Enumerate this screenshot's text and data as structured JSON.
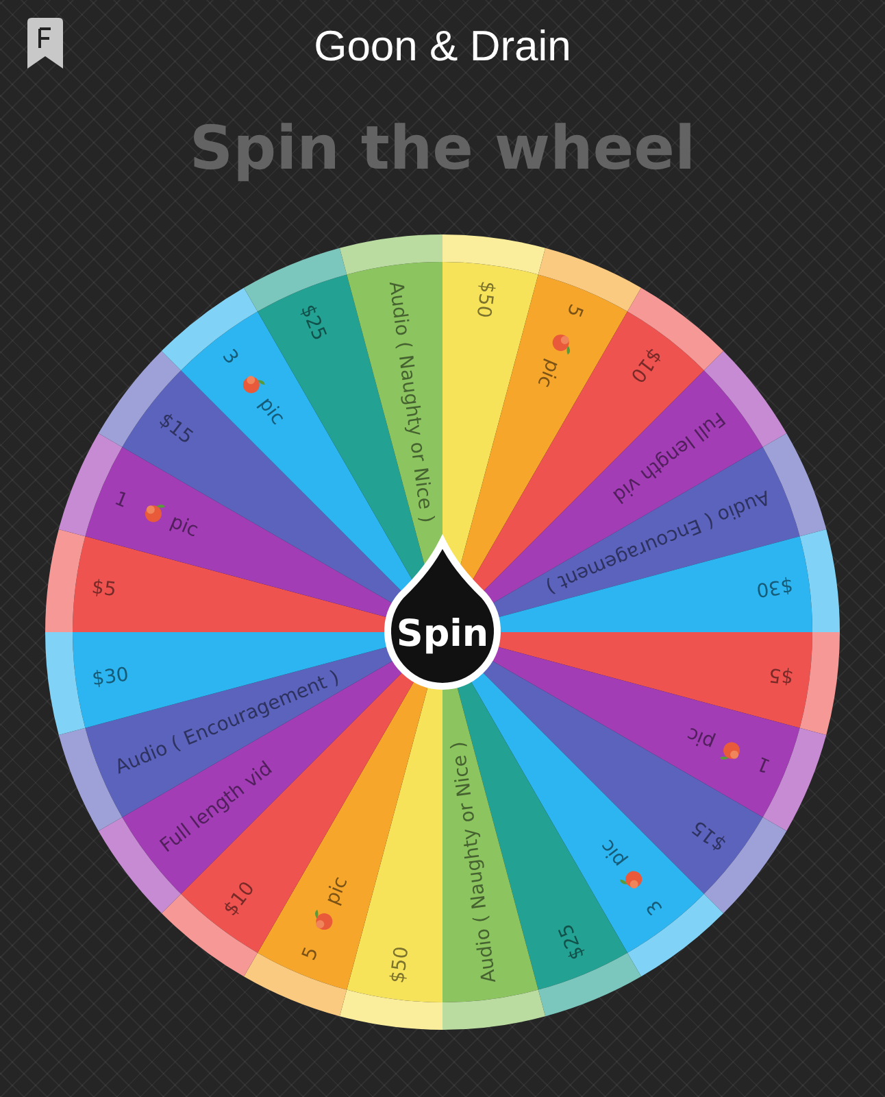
{
  "app_bar": {
    "title": "Goon & Drain"
  },
  "heading": "Spin the wheel",
  "wheel": {
    "button": "Spin",
    "segments": [
      {
        "kind": "text",
        "label": "$50",
        "color": "#f6e35a"
      },
      {
        "kind": "pic",
        "count": "5",
        "label": "pic",
        "color": "#f7a62c"
      },
      {
        "kind": "text",
        "label": "$10",
        "color": "#ef5350"
      },
      {
        "kind": "text",
        "label": "Full length vid",
        "color": "#a23db6"
      },
      {
        "kind": "text",
        "label": "Audio ( Encouragement )",
        "color": "#5c63bd"
      },
      {
        "kind": "text",
        "label": "$30",
        "color": "#2cb5f0"
      },
      {
        "kind": "text",
        "label": "$5",
        "color": "#ef5350"
      },
      {
        "kind": "pic",
        "count": "1",
        "label": "pic",
        "color": "#a23db6"
      },
      {
        "kind": "text",
        "label": "$15",
        "color": "#5c63bd"
      },
      {
        "kind": "pic",
        "count": "3",
        "label": "pic",
        "color": "#2cb5f0"
      },
      {
        "kind": "text",
        "label": "$25",
        "color": "#23a193"
      },
      {
        "kind": "text",
        "label": "Audio ( Naughty or Nice )",
        "color": "#8cc460"
      },
      {
        "kind": "text",
        "label": "$50",
        "color": "#f6e35a"
      },
      {
        "kind": "pic",
        "count": "5",
        "label": "pic",
        "color": "#f7a62c"
      },
      {
        "kind": "text",
        "label": "$10",
        "color": "#ef5350"
      },
      {
        "kind": "text",
        "label": "Full length vid",
        "color": "#a23db6"
      },
      {
        "kind": "text",
        "label": "Audio ( Encouragement )",
        "color": "#5c63bd"
      },
      {
        "kind": "text",
        "label": "$30",
        "color": "#2cb5f0"
      },
      {
        "kind": "text",
        "label": "$5",
        "color": "#ef5350"
      },
      {
        "kind": "pic",
        "count": "1",
        "label": "pic",
        "color": "#a23db6"
      },
      {
        "kind": "text",
        "label": "$15",
        "color": "#5c63bd"
      },
      {
        "kind": "pic",
        "count": "3",
        "label": "pic",
        "color": "#2cb5f0"
      },
      {
        "kind": "text",
        "label": "$25",
        "color": "#23a193"
      },
      {
        "kind": "text",
        "label": "Audio ( Naughty or Nice )",
        "color": "#8cc460"
      }
    ]
  }
}
